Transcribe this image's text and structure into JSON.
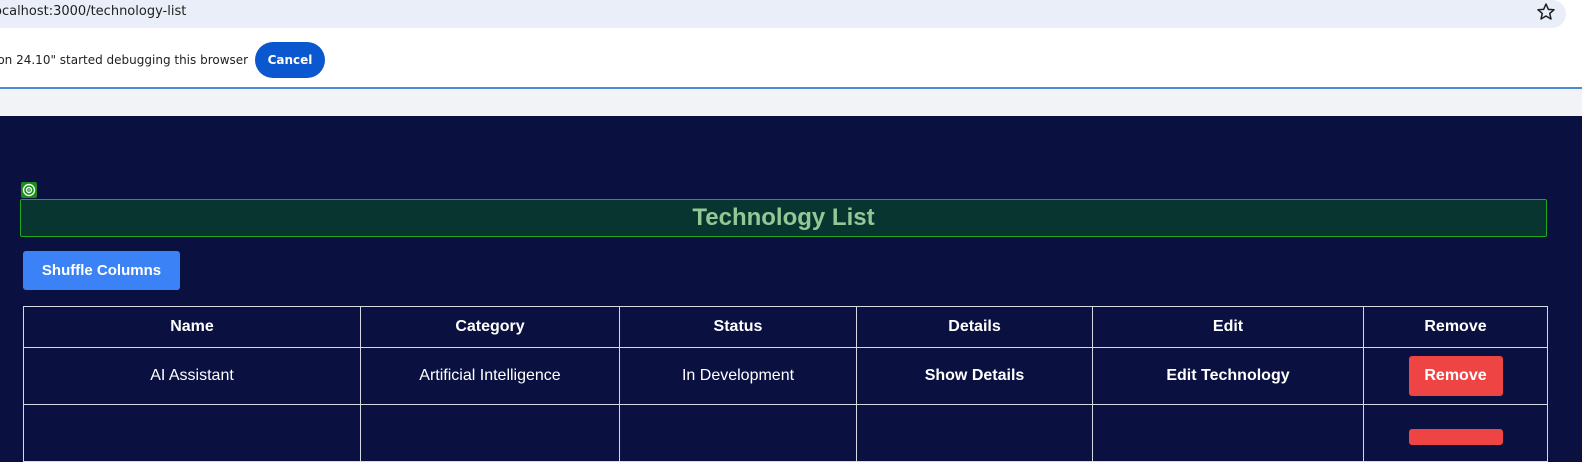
{
  "browser": {
    "url": "ocalhost:3000/technology-list",
    "star_icon": "bookmark-star-icon"
  },
  "infobar": {
    "message": "ion 24.10\" started debugging this browser",
    "cancel_label": "Cancel"
  },
  "page": {
    "title": "Technology List",
    "shuffle_label": "Shuffle Columns",
    "accent_color": "#3b82f6",
    "danger_color": "#ef4444",
    "focus_badge_icon": "target-icon"
  },
  "table": {
    "headers": [
      "Name",
      "Category",
      "Status",
      "Details",
      "Edit",
      "Remove"
    ],
    "rows": [
      {
        "name": "AI Assistant",
        "category": "Artificial Intelligence",
        "status": "In Development",
        "details": "Show Details",
        "edit": "Edit Technology",
        "remove": "Remove"
      }
    ]
  }
}
